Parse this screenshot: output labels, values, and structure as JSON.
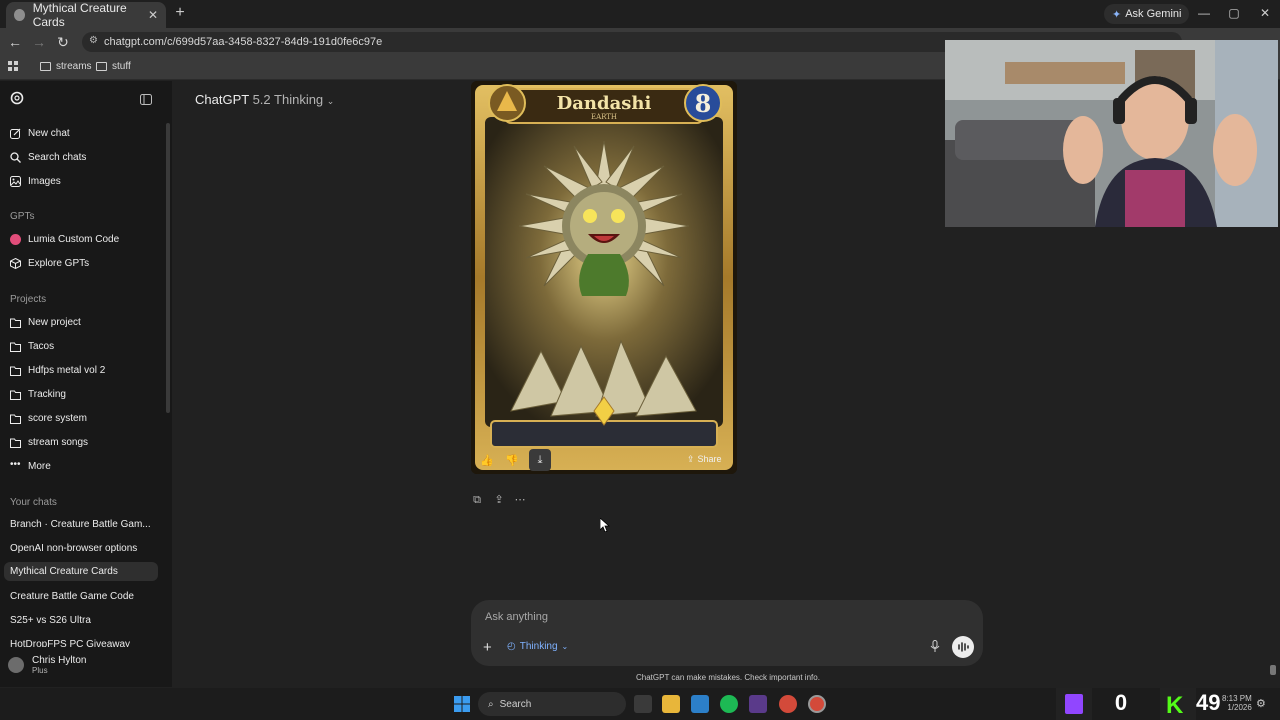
{
  "browser": {
    "tab_title": "Mythical Creature Cards",
    "new_tab": "+",
    "ask_gemini": "Ask Gemini",
    "url": "chatgpt.com/c/699d57aa-3458-8327-84d9-191d0fe6c97e",
    "bookmarks": [
      "streams",
      "stuff"
    ]
  },
  "sidebar": {
    "top_items": [
      "New chat",
      "Search chats",
      "Images"
    ],
    "gpts_heading": "GPTs",
    "gpts": [
      "Lumia Custom Code",
      "Explore GPTs"
    ],
    "projects_heading": "Projects",
    "projects": [
      "New project",
      "Tacos",
      "Hdfps metal vol 2",
      "Tracking",
      "score system",
      "stream songs",
      "More"
    ],
    "chats_heading": "Your chats",
    "chats": [
      "Branch · Creature Battle Gam...",
      "OpenAI non-browser options",
      "Mythical Creature Cards",
      "Creature Battle Game Code",
      "S25+ vs S26 Ultra",
      "HotDropFPS PC Giveaway"
    ],
    "user_name": "Chris Hylton",
    "user_plan": "Plus"
  },
  "main": {
    "model_name": "ChatGPT",
    "model_version": "5.2 Thinking",
    "card": {
      "name": "Dandashi",
      "element": "EARTH",
      "level": "8",
      "share_label": "Share"
    },
    "composer_placeholder": "Ask anything",
    "thinking_label": "Thinking",
    "disclaimer": "ChatGPT can make mistakes. Check important info."
  },
  "taskbar": {
    "search_label": "Search",
    "twitch_count": "0",
    "kick_count": "49",
    "time": "8:13 PM",
    "date": "1/2026"
  },
  "colors": {
    "sidebar_bg": "#181818",
    "main_bg": "#212121",
    "composer_bg": "#303030",
    "accent_blue": "#7fb2ff",
    "card_gold": "#c9a03c"
  }
}
